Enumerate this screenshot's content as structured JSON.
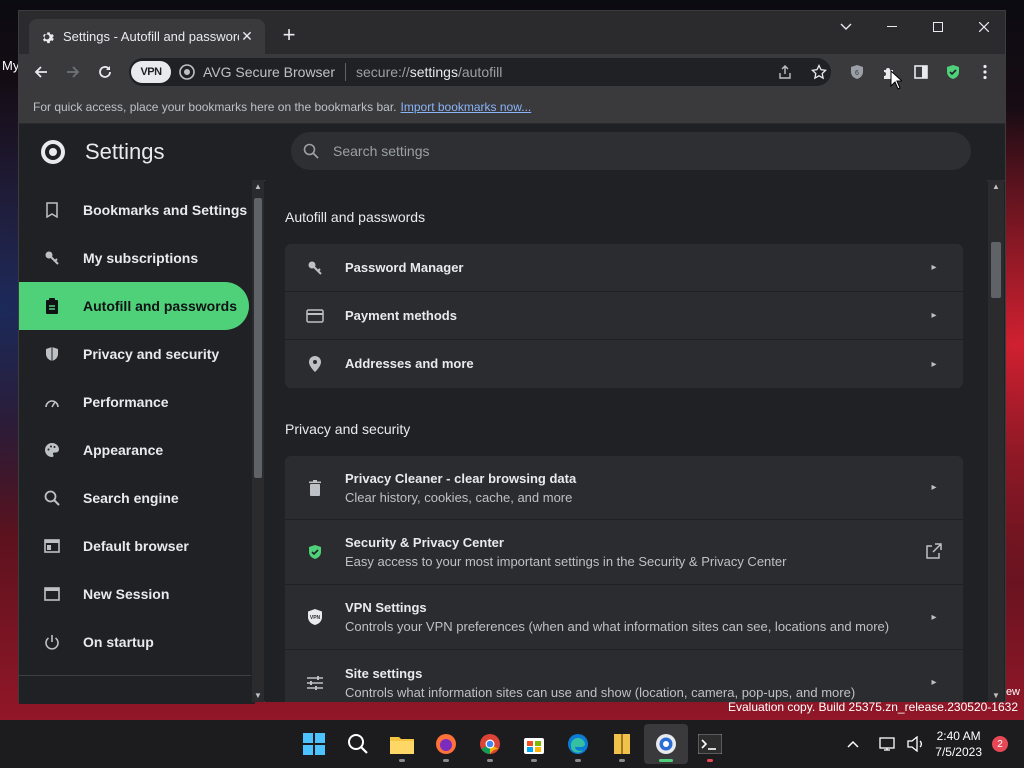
{
  "desktop": {
    "left_text": "My",
    "right_text": "ew",
    "eval_notice": "Evaluation copy. Build 25375.zn_release.230520-1632"
  },
  "browser": {
    "tab": {
      "title": "Settings - Autofill and passwords",
      "icon": "gear-icon"
    },
    "omnibox": {
      "vpn_label": "VPN",
      "site_name": "AVG Secure Browser",
      "url_scheme": "secure://",
      "url_host": "settings",
      "url_path": "/autofill"
    },
    "bookmarks_bar": {
      "message": "For quick access, place your bookmarks here on the bookmarks bar.",
      "link": "Import bookmarks now..."
    }
  },
  "settings": {
    "title": "Settings",
    "search_placeholder": "Search settings",
    "nav": [
      {
        "label": "Bookmarks and Settings",
        "icon": "bookmark-icon"
      },
      {
        "label": "My subscriptions",
        "icon": "key-icon"
      },
      {
        "label": "Autofill and passwords",
        "icon": "clipboard-icon",
        "active": true
      },
      {
        "label": "Privacy and security",
        "icon": "shield-icon"
      },
      {
        "label": "Performance",
        "icon": "gauge-icon"
      },
      {
        "label": "Appearance",
        "icon": "palette-icon"
      },
      {
        "label": "Search engine",
        "icon": "search-icon"
      },
      {
        "label": "Default browser",
        "icon": "browser-icon"
      },
      {
        "label": "New Session",
        "icon": "window-icon"
      },
      {
        "label": "On startup",
        "icon": "power-icon"
      }
    ],
    "sections": [
      {
        "title": "Autofill and passwords",
        "rows": [
          {
            "label": "Password Manager",
            "icon": "key-icon"
          },
          {
            "label": "Payment methods",
            "icon": "credit-card-icon"
          },
          {
            "label": "Addresses and more",
            "icon": "location-pin-icon"
          }
        ]
      },
      {
        "title": "Privacy and security",
        "rows": [
          {
            "label": "Privacy Cleaner - clear browsing data",
            "sub": "Clear history, cookies, cache, and more",
            "icon": "trash-icon"
          },
          {
            "label": "Security & Privacy Center",
            "sub": "Easy access to your most important settings in the Security & Privacy Center",
            "icon": "shield-check-icon",
            "external": true
          },
          {
            "label": "VPN Settings",
            "sub": "Controls your VPN preferences (when and what information sites can see, locations and more)",
            "icon": "vpn-shield-icon"
          },
          {
            "label": "Site settings",
            "sub": "Controls what information sites can use and show (location, camera, pop-ups, and more)",
            "icon": "sliders-icon"
          }
        ]
      }
    ]
  },
  "taskbar": {
    "time": "2:40 AM",
    "date": "7/5/2023",
    "notifications": "2"
  },
  "colors": {
    "accent": "#4fd17a",
    "window_bg": "#202124",
    "card_bg": "#2b2c2f"
  }
}
